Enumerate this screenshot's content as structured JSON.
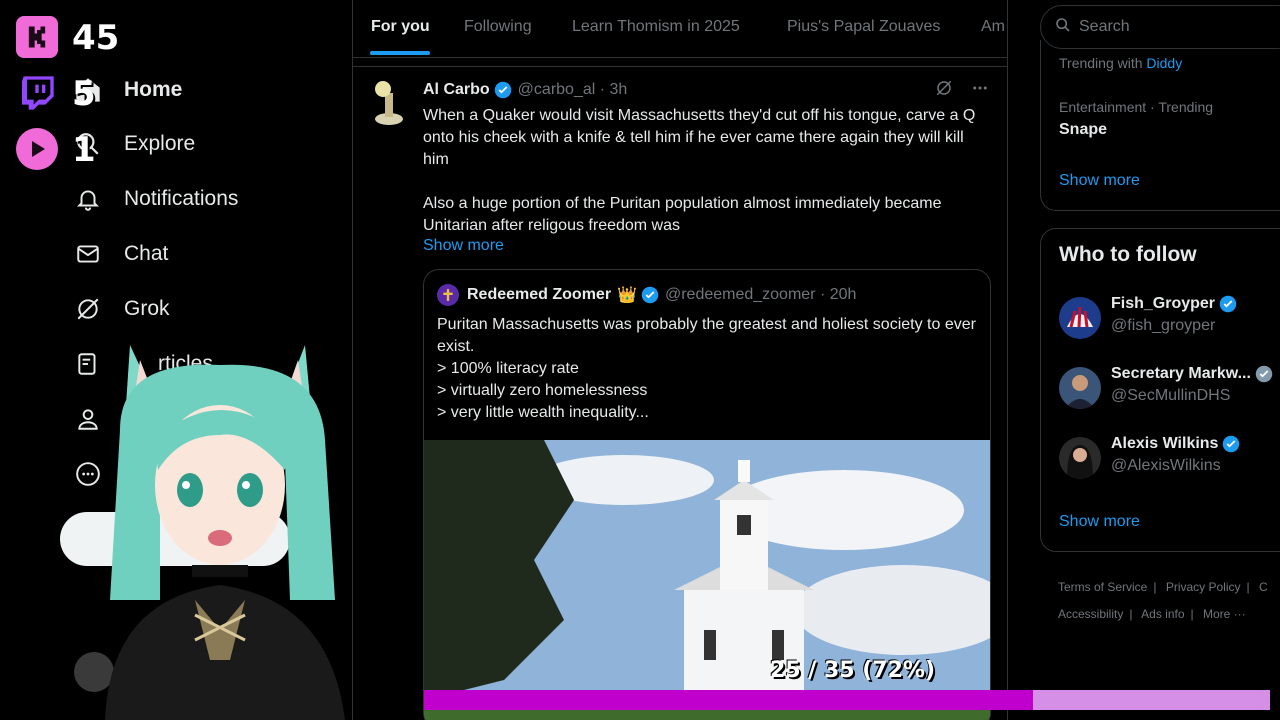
{
  "overlay": {
    "counter_top": "45",
    "counter_twitch": "5",
    "counter_kick": "1",
    "progress_text": "25 / 35 (72%)",
    "progress_fraction": 0.72,
    "colors": {
      "kick": "#f06ad8",
      "twitch": "#9146ff",
      "progress_fill": "#c000cc",
      "progress_track": "#d58fe6"
    }
  },
  "left_nav": {
    "items": [
      {
        "label": "Home",
        "icon": "home-icon",
        "active": true
      },
      {
        "label": "Explore",
        "icon": "search-icon"
      },
      {
        "label": "Notifications",
        "icon": "bell-icon"
      },
      {
        "label": "Chat",
        "icon": "mail-icon"
      },
      {
        "label": "Grok",
        "icon": "grok-icon"
      },
      {
        "label": "Articles",
        "icon": "articles-icon"
      },
      {
        "label": "Profile",
        "icon": "person-icon"
      },
      {
        "label": "More",
        "icon": "more-icon"
      }
    ],
    "visible_articles_fragment": "rticles"
  },
  "tabs": [
    "For you",
    "Following",
    "Learn Thomism in 2025",
    "Pius's Papal Zouaves",
    "Am"
  ],
  "tweet": {
    "name": "Al Carbo",
    "handle": "@carbo_al · 3h",
    "body": "When a Quaker would visit Massachusetts they'd cut off his tongue, carve a Q onto his cheek with a knife & tell him if he ever came there again they will kill him\n\nAlso a huge portion of the Puritan population almost immediately became Unitarian after religous freedom was",
    "show_more": "Show more",
    "quote": {
      "name": "Redeemed Zoomer",
      "crown": "👑",
      "handle": "@redeemed_zoomer · 20h",
      "body": "Puritan Massachusetts was probably the greatest and holiest society to ever exist.\n> 100% literacy rate\n> virtually zero homelessness\n> very little wealth inequality..."
    }
  },
  "right": {
    "search_placeholder": "Search",
    "trend_prefix": "Trending with",
    "trend_highlight": "Diddy",
    "trend_category": "Entertainment · Trending",
    "trend_name": "Snape",
    "show_more": "Show more",
    "who_to_follow": "Who to follow",
    "follow": [
      {
        "name": "Fish_Groyper",
        "handle": "@fish_groyper",
        "verified": true
      },
      {
        "name": "Secretary Markw...",
        "handle": "@SecMullinDHS",
        "verified": true
      },
      {
        "name": "Alexis Wilkins",
        "handle": "@AlexisWilkins",
        "verified": true
      }
    ],
    "footer": {
      "terms": "Terms of Service",
      "privacy": "Privacy Policy",
      "c": "C",
      "accessibility": "Accessibility",
      "ads": "Ads info",
      "more": "More ···"
    }
  },
  "colors": {
    "accent": "#1d9bf0",
    "text": "#e7e9ea",
    "muted": "#71767b",
    "border": "#2f3336"
  }
}
